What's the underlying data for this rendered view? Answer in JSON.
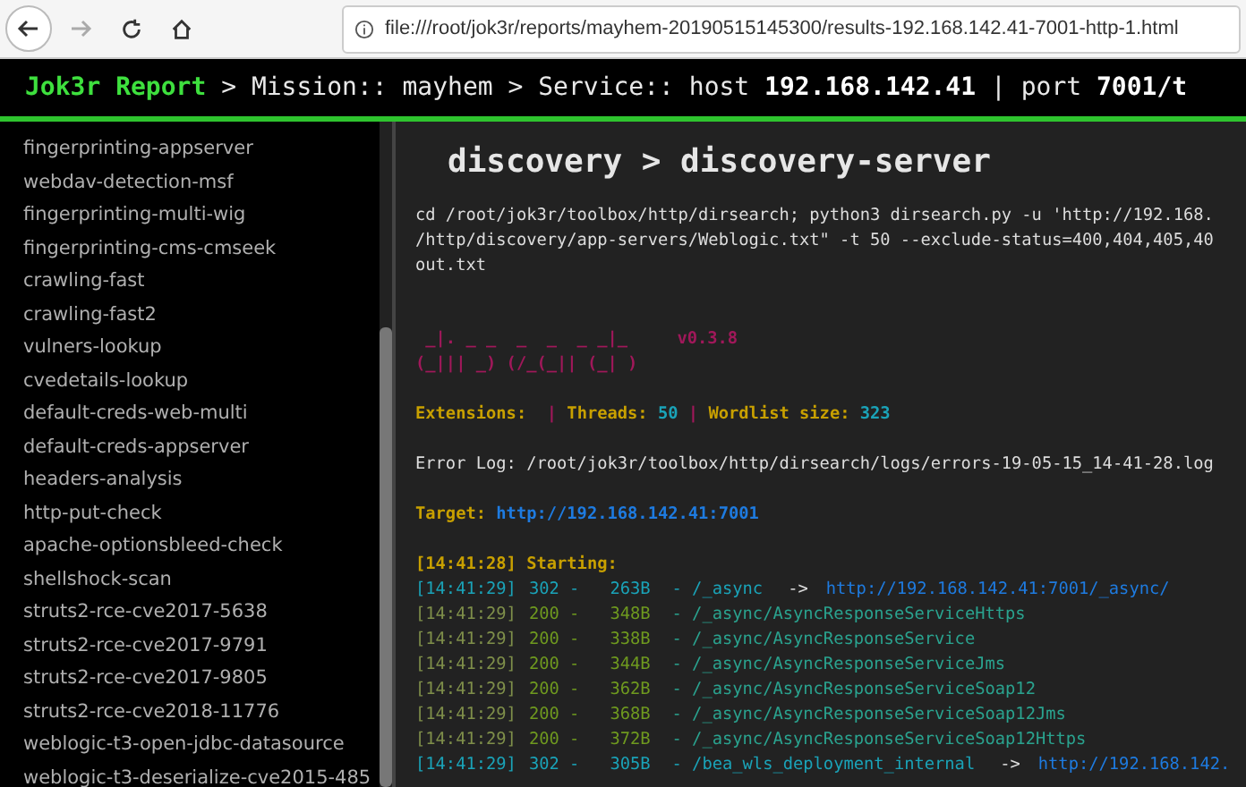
{
  "browser": {
    "url": "file:///root/jok3r/reports/mayhem-20190515145300/results-192.168.142.41-7001-http-1.html",
    "back_disabled": false,
    "forward_disabled": true
  },
  "header": {
    "brand": "Jok3r Report",
    "parts": [
      {
        "text": " > Mission:: ",
        "bold": false
      },
      {
        "text": "mayhem",
        "bold": false
      },
      {
        "text": " > Service:: host ",
        "bold": false
      },
      {
        "text": "192.168.142.41",
        "bold": true
      },
      {
        "text": " | port ",
        "bold": false
      },
      {
        "text": "7001/t",
        "bold": true
      }
    ]
  },
  "sidebar": {
    "items": [
      {
        "label": "fingerprinting-appserver"
      },
      {
        "label": "webdav-detection-msf"
      },
      {
        "label": "fingerprinting-multi-wig"
      },
      {
        "label": "fingerprinting-cms-cmseek"
      },
      {
        "label": "crawling-fast"
      },
      {
        "label": "crawling-fast2"
      },
      {
        "label": "vulners-lookup"
      },
      {
        "label": "cvedetails-lookup"
      },
      {
        "label": "default-creds-web-multi"
      },
      {
        "label": "default-creds-appserver"
      },
      {
        "label": "headers-analysis"
      },
      {
        "label": "http-put-check"
      },
      {
        "label": "apache-optionsbleed-check"
      },
      {
        "label": "shellshock-scan"
      },
      {
        "label": "struts2-rce-cve2017-5638"
      },
      {
        "label": "struts2-rce-cve2017-9791"
      },
      {
        "label": "struts2-rce-cve2017-9805"
      },
      {
        "label": "struts2-rce-cve2018-11776"
      },
      {
        "label": "weblogic-t3-open-jdbc-datasource"
      },
      {
        "label": "weblogic-t3-deserialize-cve2015-485"
      }
    ]
  },
  "content": {
    "title": "discovery > discovery-server",
    "command": [
      "cd /root/jok3r/toolbox/http/dirsearch; python3 dirsearch.py -u 'http://192.168.",
      "/http/discovery/app-servers/Weblogic.txt\" -t 50 --exclude-status=400,404,405,40",
      "out.txt"
    ],
    "banner": {
      "art": [
        " _|. _ _  _  _  _ _|_",
        "(_||| _) (/_(_|| (_| )"
      ],
      "version": "v0.3.8"
    },
    "settings": {
      "extensions_label": "Extensions: ",
      "sep": "|",
      "threads_label": " Threads: ",
      "threads": "50",
      "sep2": "|",
      "wordlist_label": " Wordlist size: ",
      "wordlist": "323"
    },
    "error_log": "Error Log: /root/jok3r/toolbox/http/dirsearch/logs/errors-19-05-15_14-41-28.log",
    "target_label": "Target: ",
    "target": "http://192.168.142.41:7001",
    "starting": "[14:41:28] Starting:",
    "lines": [
      {
        "kind": "redirect",
        "time": "[14:41:29]",
        "code": "302 -",
        "size": "263B",
        "path": "- /_async",
        "arrow": "->",
        "link": "http://192.168.142.41:7001/_async/"
      },
      {
        "kind": "ok",
        "time": "[14:41:29]",
        "code": "200 -",
        "size": "348B",
        "path": "- /_async/AsyncResponseServiceHttps"
      },
      {
        "kind": "ok",
        "time": "[14:41:29]",
        "code": "200 -",
        "size": "338B",
        "path": "- /_async/AsyncResponseService"
      },
      {
        "kind": "ok",
        "time": "[14:41:29]",
        "code": "200 -",
        "size": "344B",
        "path": "- /_async/AsyncResponseServiceJms"
      },
      {
        "kind": "ok",
        "time": "[14:41:29]",
        "code": "200 -",
        "size": "362B",
        "path": "- /_async/AsyncResponseServiceSoap12"
      },
      {
        "kind": "ok",
        "time": "[14:41:29]",
        "code": "200 -",
        "size": "368B",
        "path": "- /_async/AsyncResponseServiceSoap12Jms"
      },
      {
        "kind": "ok",
        "time": "[14:41:29]",
        "code": "200 -",
        "size": "372B",
        "path": "- /_async/AsyncResponseServiceSoap12Https"
      },
      {
        "kind": "redirect",
        "time": "[14:41:29]",
        "code": "302 -",
        "size": "305B",
        "path": "- /bea_wls_deployment_internal",
        "arrow": "->",
        "link": "http://192.168.142."
      }
    ]
  }
}
